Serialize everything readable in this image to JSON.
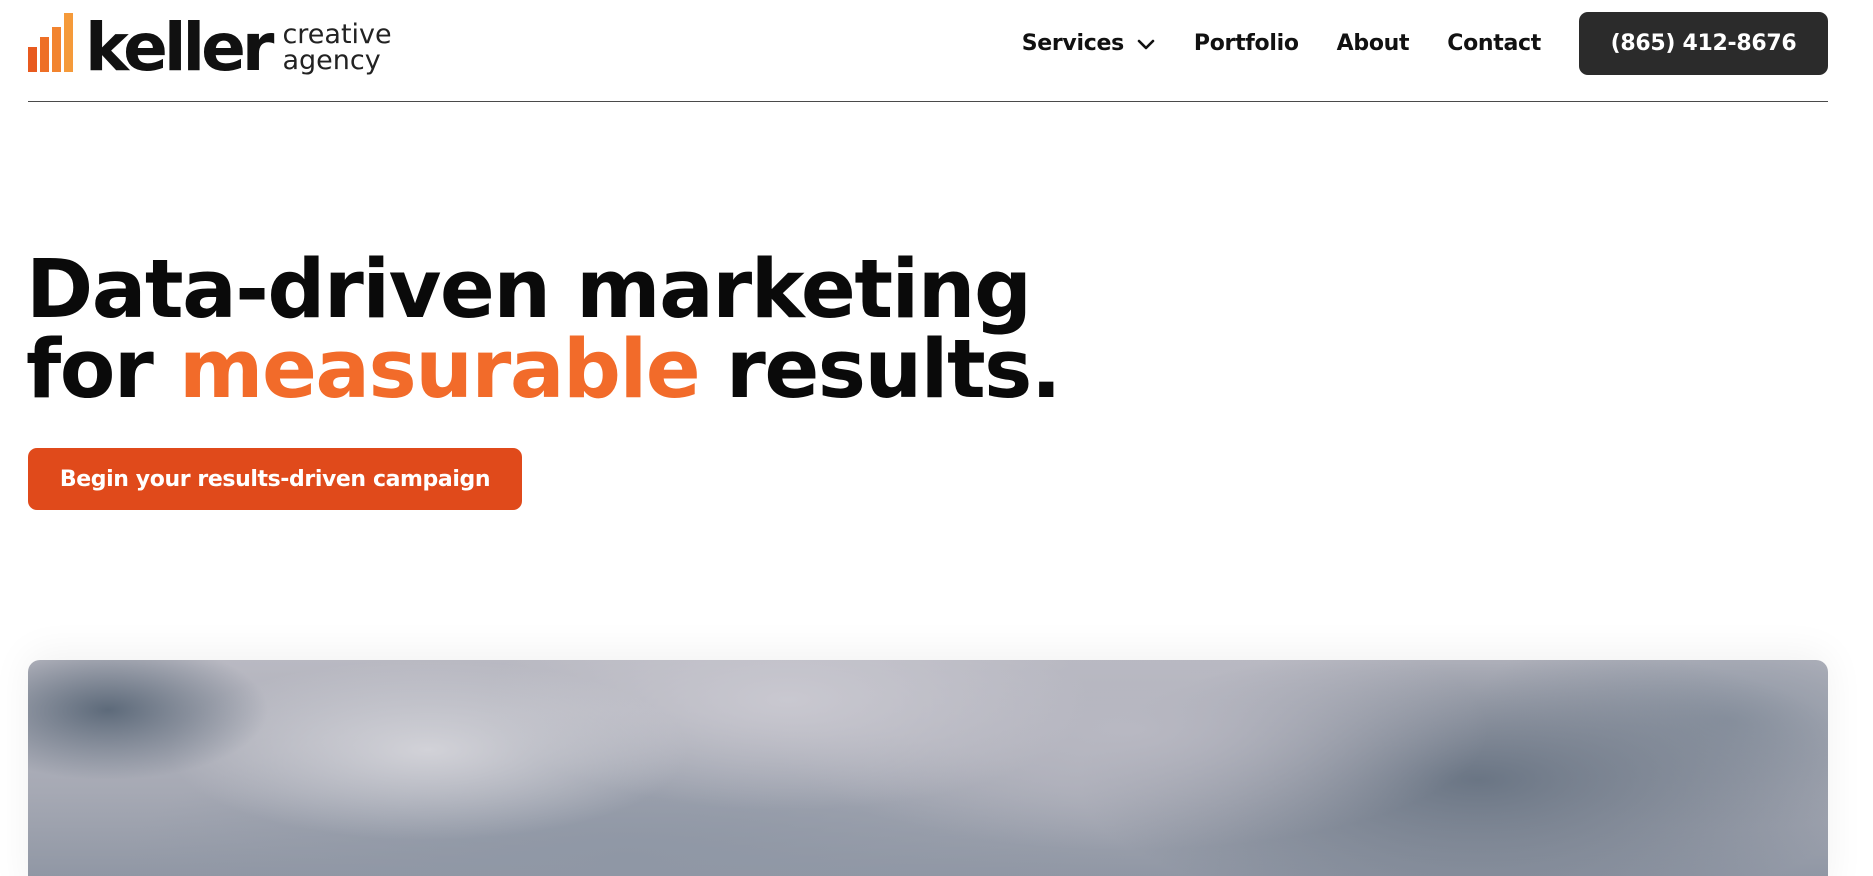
{
  "header": {
    "logo": {
      "wordmark": "keller",
      "sub_line1": "creative",
      "sub_line2": "agency"
    },
    "nav": [
      {
        "label": "Services",
        "has_dropdown": true
      },
      {
        "label": "Portfolio"
      },
      {
        "label": "About"
      },
      {
        "label": "Contact"
      }
    ],
    "phone_button": "(865) 412-8676"
  },
  "hero": {
    "line1": "Data-driven marketing",
    "line2_before": "for",
    "line2_accent": "measurable",
    "line2_after": "results.",
    "cta": "Begin your results-driven campaign"
  },
  "colors": {
    "accent_text": "#f26b2a",
    "cta_background": "#e04a1b",
    "phone_button_background": "#2b2b2b",
    "divider": "#4a4a4a"
  },
  "icons": {
    "logo_mark": "orange-bar-chart-icon",
    "services_dropdown": "chevron-down-icon"
  }
}
